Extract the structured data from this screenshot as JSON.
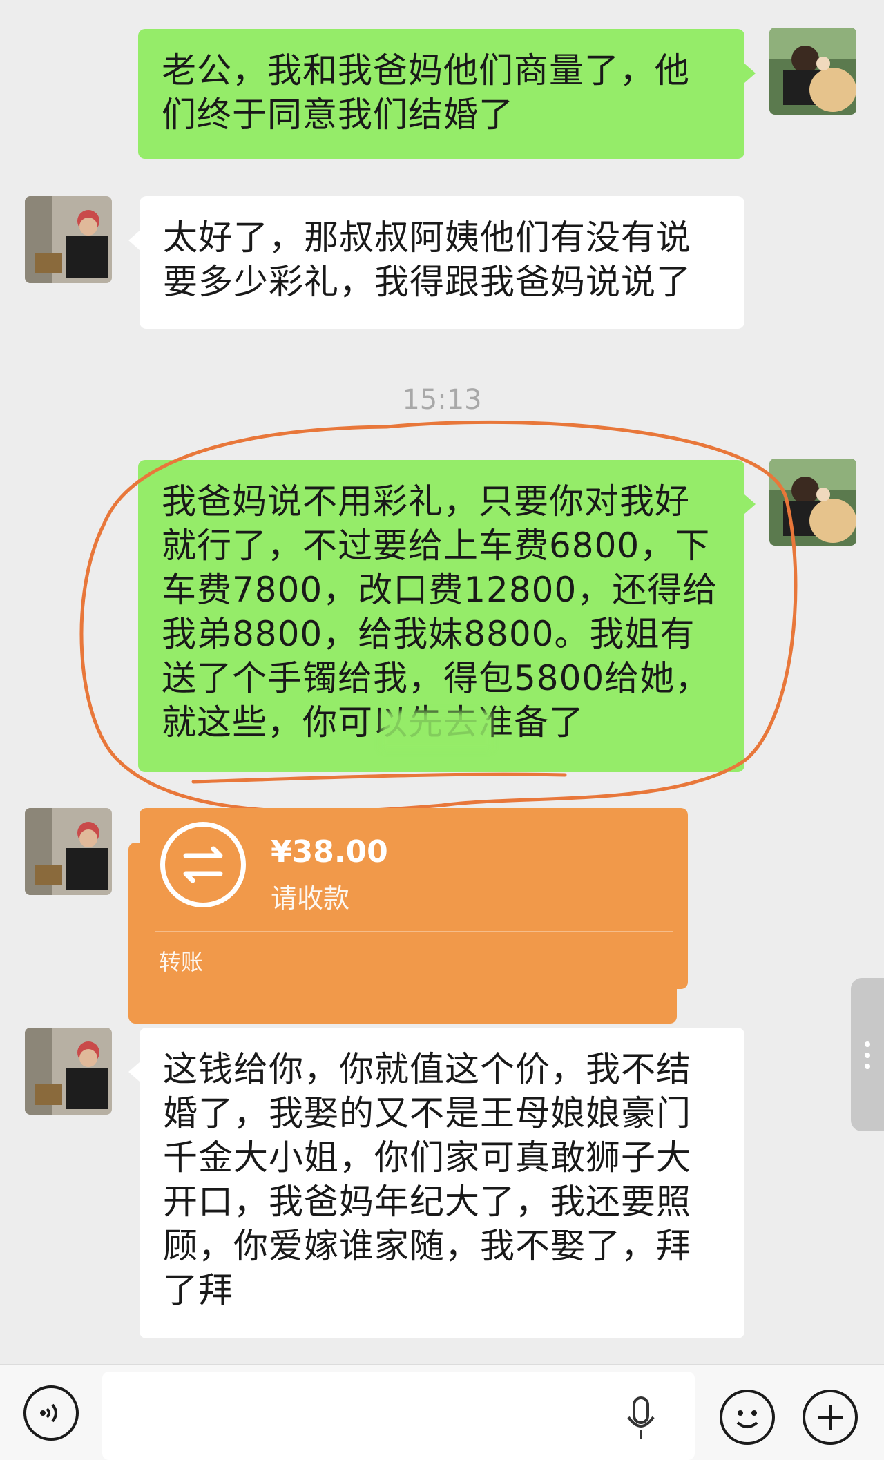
{
  "messages": [
    {
      "from": "me",
      "text": "老公，我和我爸妈他们商量了，他们终于同意我们结婚了"
    },
    {
      "from": "them",
      "text": "太好了，那叔叔阿姨他们有没有说要多少彩礼，我得跟我爸妈说说了"
    },
    {
      "timestamp": "15:13"
    },
    {
      "from": "me",
      "text": "我爸妈说不用彩礼，只要你对我好就行了，不过要给上车费6800，下车费7800，改口费12800，还得给我弟8800，给我妹8800。我姐有送了个手镯给我，得包5800给她，就这些，你可以先去准备了"
    },
    {
      "from": "them",
      "type": "transfer",
      "amount": "¥38.00",
      "status": "请收款",
      "label": "转账"
    },
    {
      "from": "them",
      "text": "这钱给你，你就值这个价，我不结婚了，我娶的又不是王母娘娘豪门千金大小姐，你们家可真敢狮子大开口，我爸妈年纪大了，我还要照顾，你爱嫁谁家随，我不娶了，拜了拜"
    }
  ],
  "colors": {
    "me_bubble": "#95ec69",
    "them_bubble": "#ffffff",
    "transfer": "#f1994a",
    "background": "#ededed",
    "annotation": "#e8773a"
  },
  "icons": {
    "voice": "voice-icon",
    "mic": "mic-icon",
    "emoji": "emoji-icon",
    "plus": "plus-icon",
    "transfer": "transfer-arrows-icon"
  }
}
